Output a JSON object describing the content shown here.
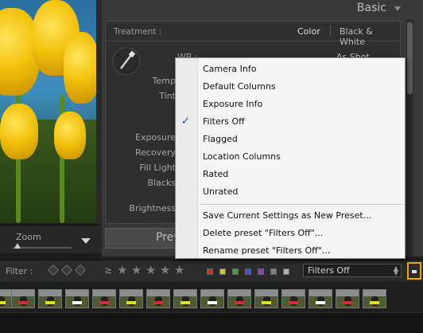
{
  "panel": {
    "title": "Basic",
    "treatment_label": "Treatment :",
    "treatment_color": "Color",
    "treatment_bw": "Black & White",
    "wb_label": "WB :",
    "wb_value": "As Shot",
    "sliders": [
      "Temp",
      "Tint",
      "Exposure",
      "Recovery",
      "Fill Light",
      "Blacks",
      "Brightness"
    ],
    "preview_button": "Prev"
  },
  "zoom": {
    "label": "Zoom"
  },
  "filter_bar": {
    "label": "Filter :",
    "rating_operator": "≥",
    "stars": [
      "★",
      "★",
      "★",
      "★",
      "★"
    ],
    "color_labels": [
      "#c83232",
      "#c8c832",
      "#3ca03c",
      "#3c50c8",
      "#8c3cb4",
      "#808080",
      "#b0b0b0"
    ],
    "preset_selected": "Filters Off"
  },
  "menu": {
    "items": [
      "Camera Info",
      "Default Columns",
      "Exposure Info",
      "Filters Off",
      "Flagged",
      "Location Columns",
      "Rated",
      "Unrated",
      "Save Current Settings as New Preset...",
      "Delete preset \"Filters Off\"...",
      "Rename preset \"Filters Off\"..."
    ],
    "checked_index": 3,
    "check_mark": "✓"
  },
  "accent_color": "#f0a700"
}
